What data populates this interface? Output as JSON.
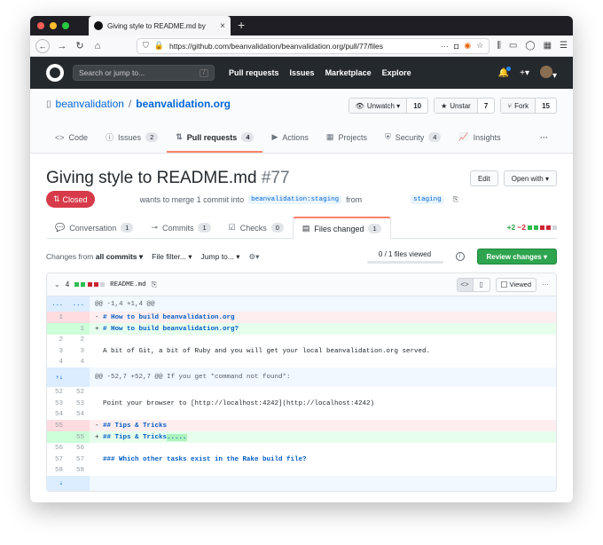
{
  "browser": {
    "tab_title": "Giving style to README.md by",
    "url": "https://github.com/beanvalidation/beanvalidation.org/pull/77/files"
  },
  "github": {
    "search_placeholder": "Search or jump to...",
    "search_shortcut": "/",
    "nav": [
      "Pull requests",
      "Issues",
      "Marketplace",
      "Explore"
    ]
  },
  "repo": {
    "owner": "beanvalidation",
    "name": "beanvalidation.org",
    "actions": [
      {
        "label": "Unwatch ▾",
        "icon": "eye-icon",
        "count": "10"
      },
      {
        "label": "Unstar",
        "icon": "star-icon",
        "count": "7"
      },
      {
        "label": "Fork",
        "icon": "fork-icon",
        "count": "15"
      }
    ],
    "tabs": [
      {
        "label": "Code",
        "icon": "<>",
        "count": ""
      },
      {
        "label": "Issues",
        "icon": "ⓘ",
        "count": "2"
      },
      {
        "label": "Pull requests",
        "icon": "⇅",
        "count": "4"
      },
      {
        "label": "Actions",
        "icon": "▶",
        "count": ""
      },
      {
        "label": "Projects",
        "icon": "▦",
        "count": ""
      },
      {
        "label": "Security",
        "icon": "⛨",
        "count": "4"
      },
      {
        "label": "Insights",
        "icon": "📈",
        "count": ""
      }
    ],
    "more": "···"
  },
  "pr": {
    "title": "Giving style to README.md",
    "number": "#77",
    "edit_label": "Edit",
    "open_with_label": "Open with ▾",
    "status": "Closed",
    "merge_text": "wants to merge 1 commit into",
    "base_branch": "beanvalidation:staging",
    "from_text": "from",
    "head_branch": "staging",
    "tabs": [
      {
        "label": "Conversation",
        "count": "1"
      },
      {
        "label": "Commits",
        "count": "1"
      },
      {
        "label": "Checks",
        "count": "0"
      },
      {
        "label": "Files changed",
        "count": "1"
      }
    ],
    "additions": "+2",
    "deletions": "−2"
  },
  "toolbar": {
    "changes_prefix": "Changes from",
    "changes_value": "all commits ▾",
    "file_filter": "File filter... ▾",
    "jump_to": "Jump to... ▾",
    "gear": "⚙▾",
    "files_viewed": "0 / 1 files viewed",
    "review_button": "Review changes ▾"
  },
  "file": {
    "changes": "4",
    "name": "README.md",
    "viewed_label": "Viewed",
    "more": "···",
    "lines": [
      {
        "type": "hunk",
        "old": "...",
        "new": "...",
        "text": "@@ -1,4 +1,4 @@"
      },
      {
        "type": "del",
        "old": "1",
        "new": "",
        "prefix": "- ",
        "text": "# How to build beanvalidation.org"
      },
      {
        "type": "add",
        "old": "",
        "new": "1",
        "prefix": "+ ",
        "text": "# How to build beanvalidation.org?"
      },
      {
        "type": "ctx",
        "old": "2",
        "new": "2",
        "prefix": "",
        "text": ""
      },
      {
        "type": "ctx",
        "old": "3",
        "new": "3",
        "prefix": "",
        "text": "  A bit of Git, a bit of Ruby and you will get your local beanvalidation.org served."
      },
      {
        "type": "ctx",
        "old": "4",
        "new": "4",
        "prefix": "",
        "text": ""
      },
      {
        "type": "hunk",
        "old": "⇡⇣",
        "new": "",
        "text": "@@ -52,7 +52,7 @@ If you get *command not found*:"
      },
      {
        "type": "ctx",
        "old": "52",
        "new": "52",
        "prefix": "",
        "text": ""
      },
      {
        "type": "ctx",
        "old": "53",
        "new": "53",
        "prefix": "",
        "text": "  Point your browser to [http://localhost:4242](http://localhost:4242)"
      },
      {
        "type": "ctx",
        "old": "54",
        "new": "54",
        "prefix": "",
        "text": ""
      },
      {
        "type": "del",
        "old": "55",
        "new": "",
        "prefix": "- ",
        "text": "## Tips & Tricks"
      },
      {
        "type": "add",
        "old": "",
        "new": "55",
        "prefix": "+ ",
        "text": "## Tips & Tricks....."
      },
      {
        "type": "ctx",
        "old": "56",
        "new": "56",
        "prefix": "",
        "text": ""
      },
      {
        "type": "ctx",
        "old": "57",
        "new": "57",
        "prefix": "",
        "text": "  ### Which other tasks exist in the Rake build file?"
      },
      {
        "type": "ctx",
        "old": "58",
        "new": "58",
        "prefix": "",
        "text": ""
      },
      {
        "type": "hunk",
        "old": "⇣",
        "new": "",
        "text": ""
      }
    ]
  }
}
